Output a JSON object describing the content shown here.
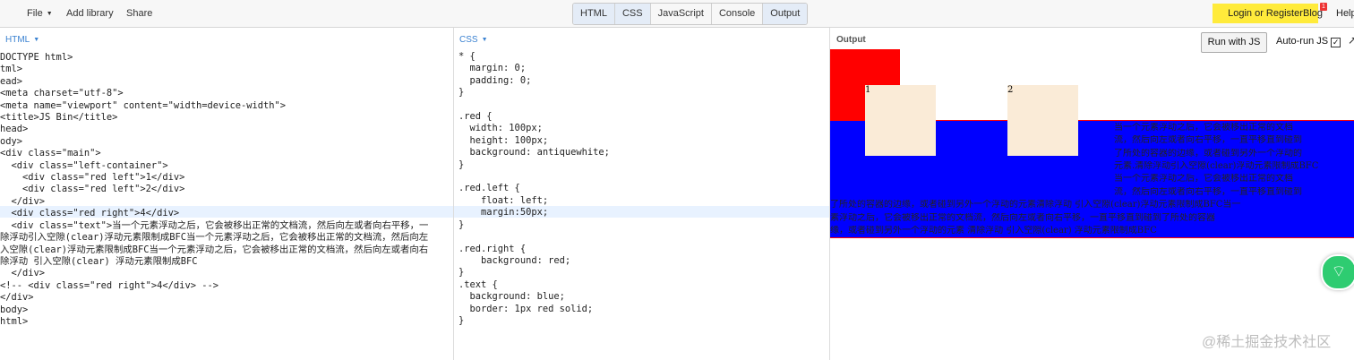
{
  "topbar": {
    "menu": [
      "File",
      "Add library",
      "Share"
    ],
    "tabs": [
      "HTML",
      "CSS",
      "JavaScript",
      "Console",
      "Output"
    ],
    "login": "Login or Register",
    "blog": "Blog",
    "blog_badge": "1",
    "help": "Help"
  },
  "html_panel": {
    "label": "HTML",
    "lines": [
      "DOCTYPE html>",
      "tml>",
      "ead>",
      "<meta charset=\"utf-8\">",
      "<meta name=\"viewport\" content=\"width=device-width\">",
      "<title>JS Bin</title>",
      "head>",
      "ody>",
      "<div class=\"main\">",
      "  <div class=\"left-container\">",
      "    <div class=\"red left\">1</div>",
      "    <div class=\"red left\">2</div>",
      "  </div>",
      "  <div class=\"red right\">4</div>",
      "  <div class=\"text\">当一个元素浮动之后，它会被移出正常的文档流，然后向左或者向右平移，一",
      "除浮动引入空隙(clear)浮动元素限制成BFC当一个元素浮动之后，它会被移出正常的文档流，然后向左",
      "入空隙(clear)浮动元素限制成BFC当一个元素浮动之后，它会被移出正常的文档流，然后向左或者向右",
      "除浮动 引入空隙(clear) 浮动元素限制成BFC",
      "  </div>",
      "<!-- <div class=\"red right\">4</div> -->",
      "</div>",
      "body>",
      "html>"
    ]
  },
  "css_panel": {
    "label": "CSS",
    "lines": [
      "* {",
      "  margin: 0;",
      "  padding: 0;",
      "}",
      "",
      ".red {",
      "  width: 100px;",
      "  height: 100px;",
      "  background: antiquewhite;",
      "}",
      "",
      ".red.left {",
      "    float: left;",
      "    margin:50px;",
      "}",
      "",
      ".red.right {",
      "    background: red;",
      "}",
      ".text {",
      "  background: blue;",
      "  border: 1px red solid;",
      "}"
    ]
  },
  "output_panel": {
    "label": "Output",
    "run_button": "Run with JS",
    "autorun": "Auto-run JS",
    "autorun_check": "✓",
    "box1": "1",
    "box2": "2",
    "text_lines": [
      "当一个元素浮动之后，它会被移出正常的文档",
      "流，然后向左或者向右平移，一直平移直到碰到",
      "了所处的容器的边缘，或者碰到另外一个浮动的",
      "元素.清除浮动引入空隙(clear)浮动元素限制成BFC",
      "当一个元素浮动之后，它会被移出正常的文档",
      "流，然后向左或者向右平移，一直平移直到碰到",
      "了所处的容器的边缘，或者碰到另外一个浮动的元素清除浮动 引入空隙(clear)浮动元素限制成BFC当一",
      "素浮动之后，它会被移出正常的文档流，然后向左或者向右平移，一直平移直到碰到了所处的容器",
      "缘，或者碰到另外一个浮动的元素 清除浮动 引入空隙(clear) 浮动元素限制成BFC"
    ]
  },
  "watermark": "@稀土掘金技术社区"
}
